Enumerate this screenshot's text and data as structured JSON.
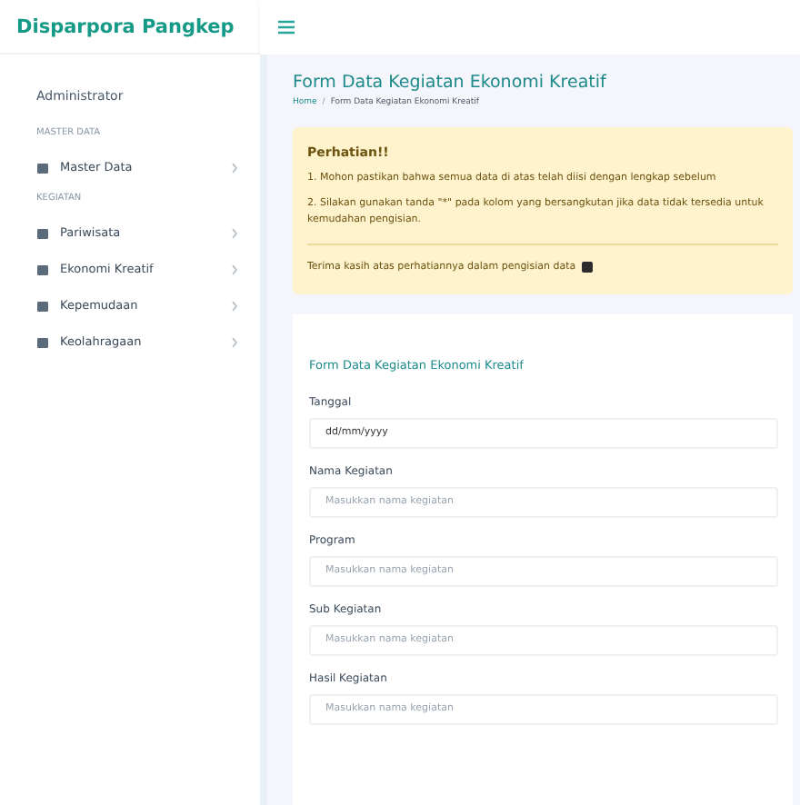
{
  "brand": "Disparpora Pangkep",
  "sidebar": {
    "items": [
      {
        "kind": "heading",
        "label": "Administrator"
      },
      {
        "kind": "section",
        "label": "MASTER DATA"
      },
      {
        "kind": "link",
        "label": "Master Data",
        "expanded": false
      },
      {
        "kind": "section",
        "label": "KEGIATAN"
      },
      {
        "kind": "link",
        "label": "Pariwisata",
        "expanded": false
      },
      {
        "kind": "link",
        "label": "Ekonomi Kreatif",
        "expanded": false
      },
      {
        "kind": "link",
        "label": "Kepemudaan",
        "expanded": false
      },
      {
        "kind": "link",
        "label": "Keolahragaan",
        "expanded": false
      }
    ]
  },
  "page": {
    "title": "Form Data Kegiatan Ekonomi Kreatif",
    "breadcrumb": [
      "Home",
      "Form Data Kegiatan Ekonomi Kreatif"
    ],
    "breadcrumb_separator": "/"
  },
  "alert": {
    "title": "Perhatian!!",
    "lines": [
      "1. Mohon pastikan bahwa semua data di atas telah diisi dengan lengkap sebelum",
      "2. Silakan gunakan tanda \"*\" pada kolom yang bersangkutan jika data tidak tersedia untuk kemudahan pengisian."
    ],
    "footer": "Terima kasih atas perhatiannya dalam pengisian data"
  },
  "form": {
    "title": "Form Data Kegiatan Ekonomi Kreatif",
    "fields": [
      {
        "label": "Tanggal",
        "value": "dd/mm/yyyy"
      },
      {
        "label": "Nama Kegiatan",
        "placeholder": "Masukkan nama kegiatan"
      },
      {
        "label": "Program",
        "placeholder": "Masukkan nama kegiatan"
      },
      {
        "label": "Sub Kegiatan",
        "placeholder": "Masukkan nama kegiatan"
      },
      {
        "label": "Hasil Kegiatan",
        "placeholder": "Masukkan nama kegiatan"
      }
    ]
  }
}
